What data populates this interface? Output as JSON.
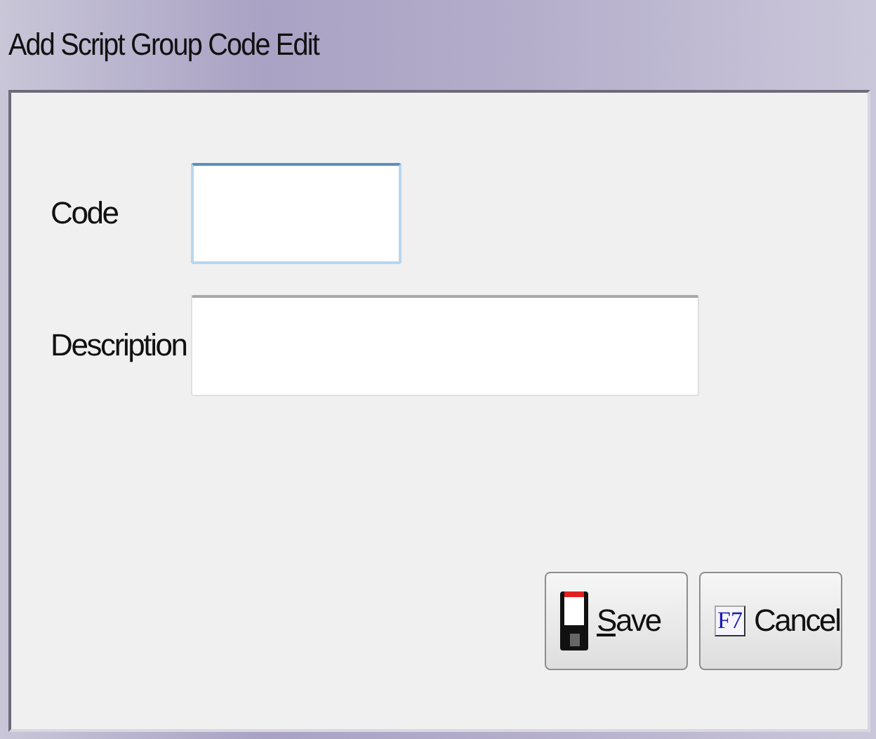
{
  "window": {
    "title": "Add Script Group Code Edit"
  },
  "fields": [
    {
      "label": "Code",
      "focused": true,
      "kind": "short"
    },
    {
      "label": "Description",
      "focused": false,
      "kind": "long"
    }
  ],
  "buttons": [
    {
      "kind": "save",
      "label": "Save",
      "underline_first": true
    },
    {
      "kind": "cancel",
      "label": "Cancel",
      "icon_text": "F7",
      "underline_first": false
    }
  ]
}
